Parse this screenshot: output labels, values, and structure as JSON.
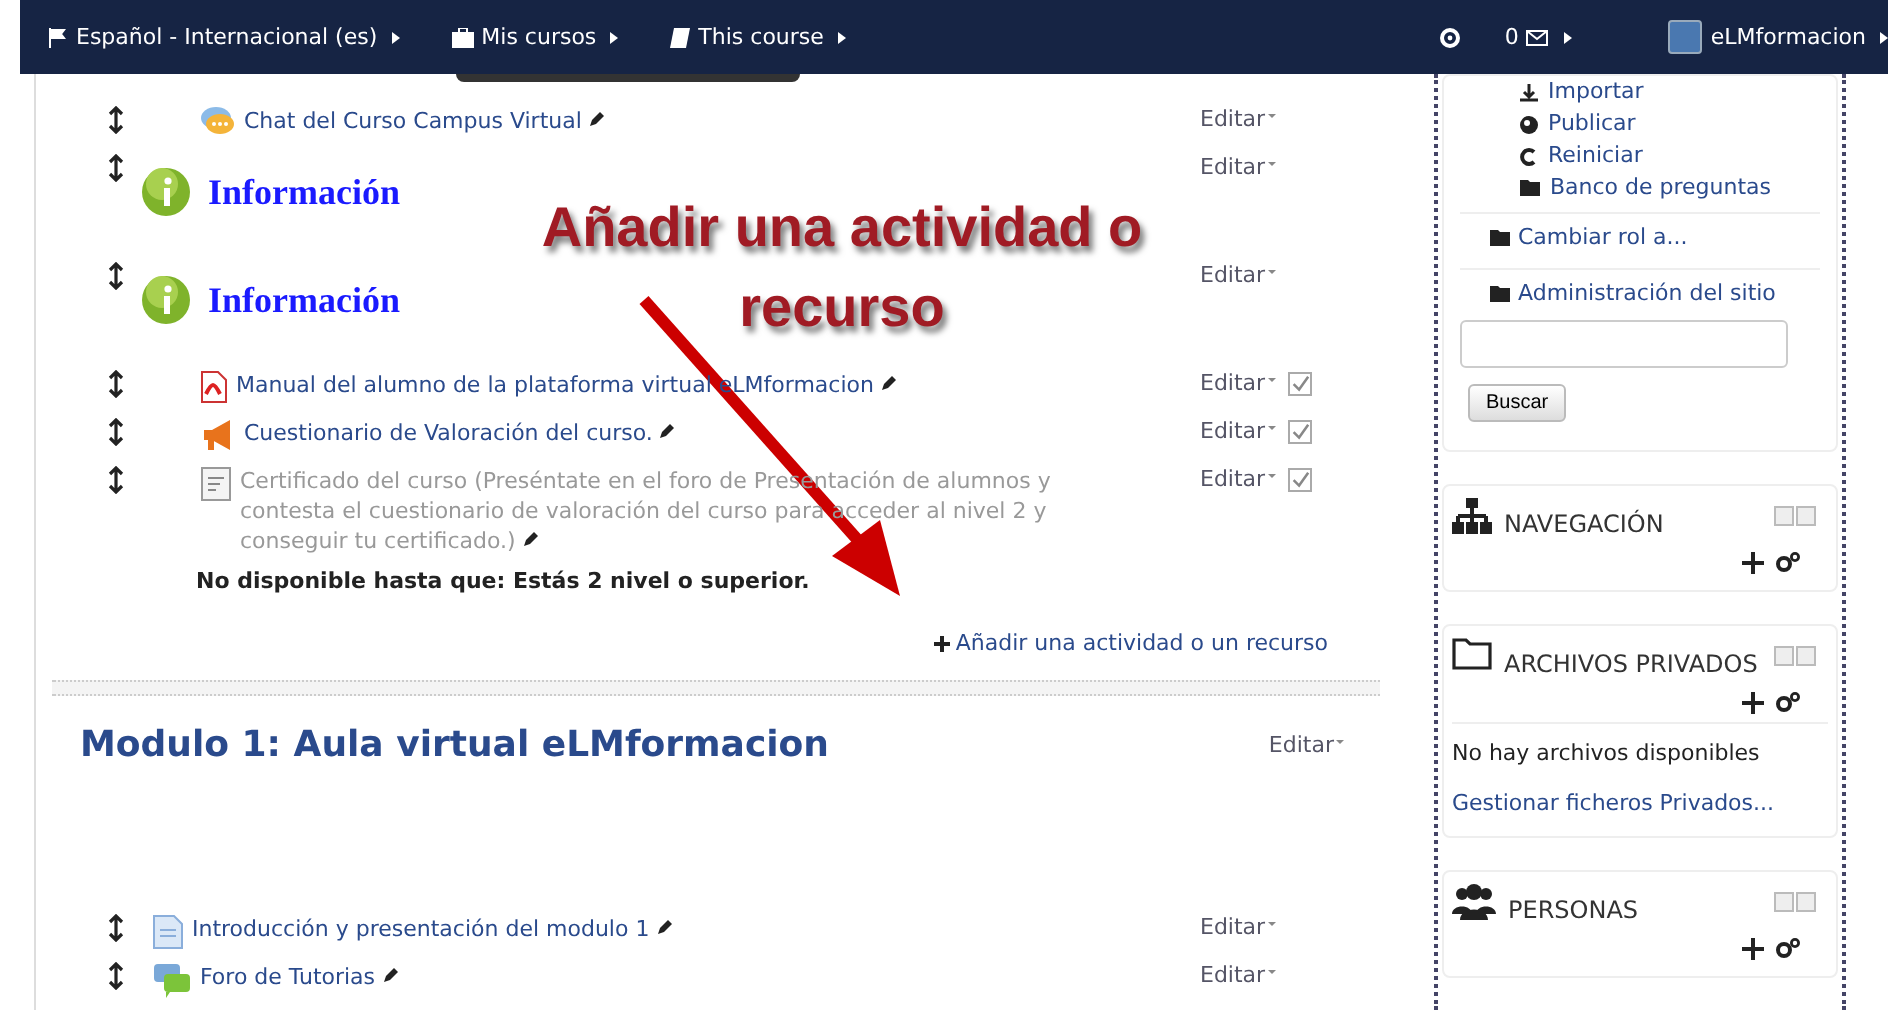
{
  "navbar": {
    "items": [
      {
        "kind": "flag",
        "label": "Español - Internacional (es)"
      },
      {
        "kind": "briefcase",
        "label": "Mis cursos"
      },
      {
        "kind": "book",
        "label": "This course"
      }
    ],
    "messages": "0",
    "user": "eLMformacion"
  },
  "section0": {
    "items": [
      {
        "kind": "chat",
        "title": "Chat del Curso Campus Virtual",
        "edit": "Editar"
      },
      {
        "kind": "label",
        "title": "Información",
        "edit": "Editar"
      },
      {
        "kind": "label",
        "title": "Información",
        "edit": "Editar"
      },
      {
        "kind": "pdf",
        "title": "Manual del alumno de la plataforma virtual eLMformacion",
        "edit": "Editar",
        "checked": true
      },
      {
        "kind": "feedback",
        "title": "Cuestionario de Valoración del curso.",
        "edit": "Editar",
        "checked": true
      },
      {
        "kind": "certificate",
        "title": "Certificado del curso (Preséntate en el foro de Presentación de alumnos y contesta el cuestionario de valoración del curso para acceder al nivel 2 y conseguir tu certificado.)",
        "edit": "Editar",
        "checked": true,
        "dimmed": true,
        "restriction": "No disponible hasta que: Estás 2 nivel o superior."
      }
    ],
    "add": "Añadir una actividad o un recurso"
  },
  "annotation": "Añadir una actividad o recurso",
  "section1": {
    "title": "Modulo 1: Aula virtual eLMformacion",
    "edit": "Editar",
    "items": [
      {
        "kind": "page",
        "title": "Introducción y presentación del modulo 1",
        "edit": "Editar"
      },
      {
        "kind": "forum",
        "title": "Foro de Tutorias",
        "edit": "Editar"
      }
    ]
  },
  "sidebar": {
    "admin_links": [
      {
        "kind": "import",
        "label": "Importar"
      },
      {
        "kind": "globe",
        "label": "Publicar"
      },
      {
        "kind": "reset",
        "label": "Reiniciar"
      },
      {
        "kind": "folder",
        "label": "Banco de preguntas"
      }
    ],
    "admin_sections": [
      "Cambiar rol a...",
      "Administración del sitio"
    ],
    "search_button": "Buscar",
    "blocks": [
      {
        "kind": "navigation",
        "title": "NAVEGACIÓN"
      },
      {
        "kind": "files",
        "title": "ARCHIVOS PRIVADOS",
        "empty": "No hay archivos disponibles",
        "link": "Gestionar ficheros Privados..."
      },
      {
        "kind": "people",
        "title": "PERSONAS"
      }
    ]
  }
}
